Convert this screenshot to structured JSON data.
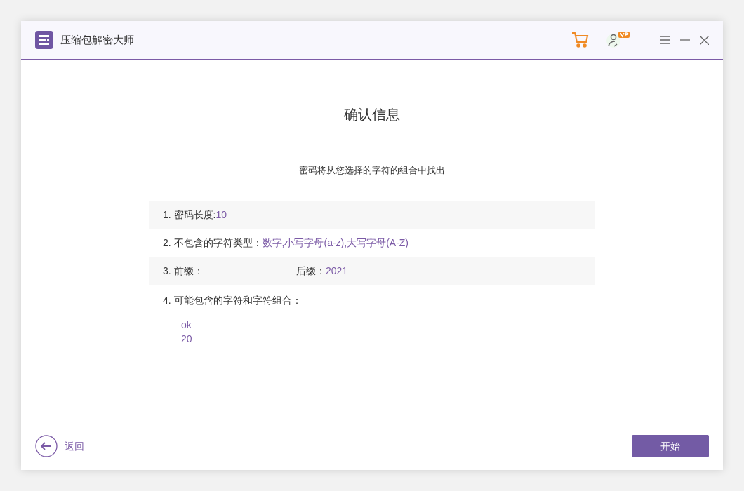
{
  "window": {
    "title": "压缩包解密大师"
  },
  "heading": "确认信息",
  "subtitle": "密码将从您选择的字符的组合中找出",
  "rows": [
    {
      "kind": "pairs",
      "parts": [
        {
          "label": "1. 密码长度: ",
          "value": "10"
        }
      ]
    },
    {
      "kind": "pairs",
      "parts": [
        {
          "label": "2. 不包含的字符类型：",
          "value": "数字,小写字母(a-z),大写字母(A-Z)"
        }
      ]
    },
    {
      "kind": "pairs",
      "parts": [
        {
          "label": "3. 前缀："
        },
        {
          "label": "后缀：",
          "value": "2021"
        }
      ]
    },
    {
      "kind": "list",
      "label": "4. 可能包含的字符和字符组合：",
      "values": [
        "ok",
        "20"
      ]
    }
  ],
  "footer": {
    "back": "返回",
    "start": "开始"
  }
}
